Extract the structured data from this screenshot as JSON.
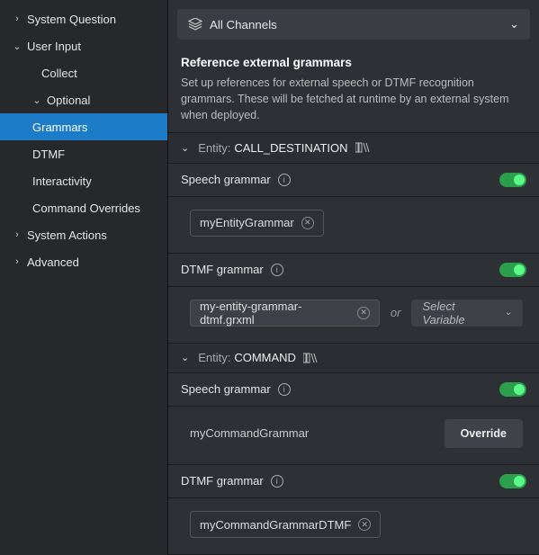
{
  "sidebar": {
    "items": [
      {
        "label": "System Question",
        "level": 1,
        "chev": "›"
      },
      {
        "label": "User Input",
        "level": 1,
        "chev": "⌄"
      },
      {
        "label": "Collect",
        "level": 2,
        "chev": ""
      },
      {
        "label": "Optional",
        "level": 3,
        "chev": "⌄"
      },
      {
        "label": "Grammars",
        "level": 4,
        "chev": "",
        "selected": true
      },
      {
        "label": "DTMF",
        "level": 4,
        "chev": ""
      },
      {
        "label": "Interactivity",
        "level": 4,
        "chev": ""
      },
      {
        "label": "Command Overrides",
        "level": 4,
        "chev": ""
      },
      {
        "label": "System Actions",
        "level": 1,
        "chev": "›"
      },
      {
        "label": "Advanced",
        "level": 1,
        "chev": "›"
      }
    ]
  },
  "channels": {
    "label": "All Channels"
  },
  "header": {
    "title": "Reference external grammars",
    "desc": "Set up references for external speech or DTMF recognition grammars. These will be fetched at runtime by an external system when deployed."
  },
  "entities": [
    {
      "label": "Entity:",
      "name": "CALL_DESTINATION",
      "speech": {
        "title": "Speech grammar",
        "chip": "myEntityGrammar",
        "removable": true,
        "toggle": true
      },
      "dtmf": {
        "title": "DTMF grammar",
        "chip": "my-entity-grammar-dtmf.grxml",
        "removable": true,
        "filled": true,
        "or": "or",
        "select": "Select Variable",
        "toggle": true
      }
    },
    {
      "label": "Entity:",
      "name": "COMMAND",
      "speech": {
        "title": "Speech grammar",
        "text": "myCommandGrammar",
        "button": "Override",
        "toggle": true
      },
      "dtmf": {
        "title": "DTMF grammar",
        "chip": "myCommandGrammarDTMF",
        "removable": true,
        "toggle": true
      }
    }
  ]
}
